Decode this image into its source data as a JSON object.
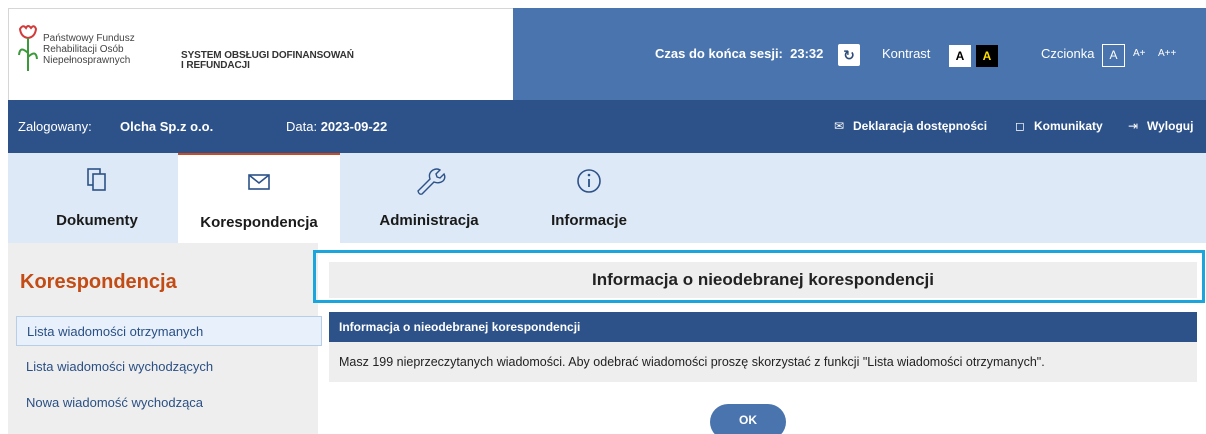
{
  "header": {
    "org_line1": "Państwowy Fundusz",
    "org_line2": "Rehabilitacji Osób",
    "org_line3": "Niepełnosprawnych",
    "system_line1": "SYSTEM OBSŁUGI DOFINANSOWAŃ",
    "system_line2": "I REFUNDACJI",
    "session_label": "Czas do końca sesji:",
    "session_time": "23:32",
    "contrast_label": "Kontrast",
    "contrast_normal": "A",
    "contrast_high": "A",
    "font_label": "Czcionka",
    "font_normal": "A",
    "font_large": "A+",
    "font_xlarge": "A++",
    "colors": {
      "brand_blue": "#4a74ad",
      "dark_blue": "#2d5289",
      "accent": "#c34b14"
    }
  },
  "infobar": {
    "logged_label": "Zalogowany:",
    "logged_name": "Olcha Sp.z o.o.",
    "date_label": "Data:",
    "date_value": "2023-09-22",
    "links": {
      "accessibility": "Deklaracja dostępności",
      "messages": "Komunikaty",
      "logout": "Wyloguj"
    }
  },
  "tabs": [
    {
      "label": "Dokumenty",
      "icon": "documents-icon"
    },
    {
      "label": "Korespondencja",
      "icon": "envelope-icon",
      "active": true
    },
    {
      "label": "Administracja",
      "icon": "wrench-icon"
    },
    {
      "label": "Informacje",
      "icon": "info-icon"
    }
  ],
  "sidebar": {
    "title": "Korespondencja",
    "items": [
      {
        "label": "Lista wiadomości otrzymanych",
        "selected": true
      },
      {
        "label": "Lista wiadomości wychodzących"
      },
      {
        "label": "Nowa wiadomość wychodząca"
      }
    ]
  },
  "main": {
    "title": "Informacja o nieodebranej korespondencji",
    "panel_header": "Informacja o nieodebranej korespondencji",
    "message": "Masz 199 nieprzeczytanych wiadomości. Aby odebrać wiadomości proszę skorzystać z funkcji \"Lista wiadomości otrzymanych\".",
    "ok_label": "OK"
  }
}
